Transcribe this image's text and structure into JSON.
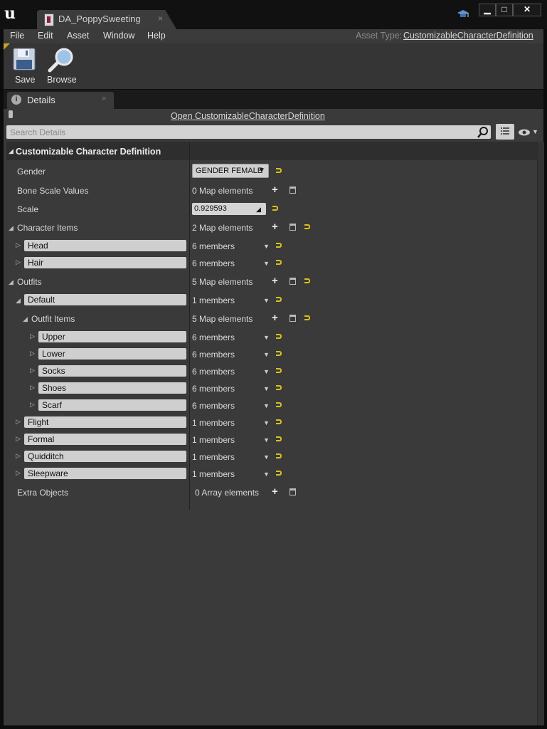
{
  "window": {
    "tab_title": "DA_PoppySweeting",
    "close_glyph": "×",
    "min_glyph": "▁",
    "max_glyph": "□",
    "close_btn_glyph": "✕"
  },
  "menu": {
    "items": [
      "File",
      "Edit",
      "Asset",
      "Window",
      "Help"
    ],
    "asset_type_label": "Asset Type:",
    "asset_type_value": "CustomizableCharacterDefinition"
  },
  "toolbar": {
    "save_label": "Save",
    "browse_label": "Browse"
  },
  "details": {
    "tab_label": "Details",
    "tab_close": "×",
    "open_link": "Open CustomizableCharacterDefinition",
    "search_placeholder": "Search Details",
    "category": "Customizable Character Definition",
    "gender_label": "Gender",
    "gender_value": "GENDER FEMALE",
    "bone_scale_label": "Bone Scale Values",
    "bone_scale_value": "0 Map elements",
    "scale_label": "Scale",
    "scale_value": "0.929593",
    "character_items_label": "Character Items",
    "character_items_value": "2 Map elements",
    "character_items": [
      {
        "name": "Head",
        "value": "6 members"
      },
      {
        "name": "Hair",
        "value": "6 members"
      }
    ],
    "outfits_label": "Outfits",
    "outfits_value": "5 Map elements",
    "default_name": "Default",
    "default_value": "1 members",
    "outfit_items_label": "Outfit Items",
    "outfit_items_value": "5 Map elements",
    "outfit_items": [
      {
        "name": "Upper",
        "value": "6 members"
      },
      {
        "name": "Lower",
        "value": "6 members"
      },
      {
        "name": "Socks",
        "value": "6 members"
      },
      {
        "name": "Shoes",
        "value": "6 members"
      },
      {
        "name": "Scarf",
        "value": "6 members"
      }
    ],
    "other_outfits": [
      {
        "name": "Flight",
        "value": "1 members"
      },
      {
        "name": "Formal",
        "value": "1 members"
      },
      {
        "name": "Quidditch",
        "value": "1 members"
      },
      {
        "name": "Sleepware",
        "value": "1 members"
      }
    ],
    "extra_objects_label": "Extra Objects",
    "extra_objects_value": "0 Array elements"
  },
  "colors": {
    "accent_yellow": "#d7c21a",
    "panel_bg": "#3a3a3a"
  },
  "icons": [
    "ue-logo-icon",
    "document-icon",
    "graduation-cap-icon",
    "save-disk-icon",
    "magnifier-icon",
    "info-icon",
    "lock-icon",
    "search-icon",
    "list-view-icon",
    "eye-icon",
    "plus-icon",
    "trash-icon",
    "reset-arrow-icon"
  ]
}
